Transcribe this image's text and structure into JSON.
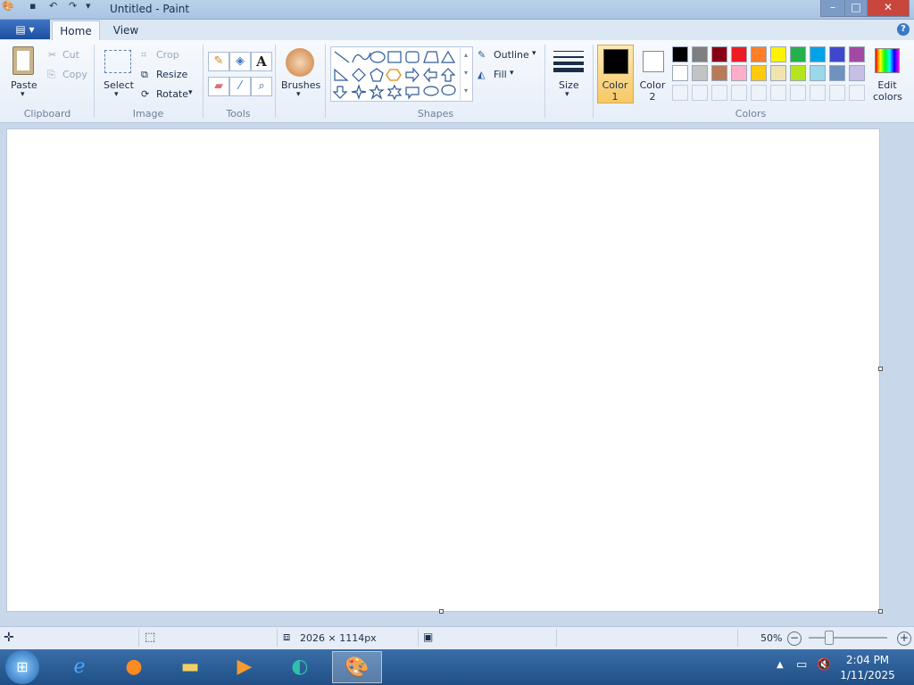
{
  "window": {
    "title": "Untitled - Paint"
  },
  "titlebar": {
    "minimize": "–",
    "maximize": "□",
    "close": "✕"
  },
  "ribbon_tabs": {
    "app_menu": "▤ ▾",
    "home": "Home",
    "view": "View"
  },
  "clipboard": {
    "paste": "Paste",
    "cut": "Cut",
    "copy": "Copy",
    "label": "Clipboard"
  },
  "image": {
    "select": "Select",
    "crop": "Crop",
    "resize": "Resize",
    "rotate": "Rotate",
    "label": "Image"
  },
  "tools": {
    "label": "Tools"
  },
  "brushes": {
    "label": "Brushes"
  },
  "shapes": {
    "outline": "Outline",
    "fill": "Fill",
    "label": "Shapes"
  },
  "size": {
    "label": "Size"
  },
  "color1": {
    "label": "Color 1",
    "value": "#000000"
  },
  "color2": {
    "label": "Color 2",
    "value": "#ffffff"
  },
  "edit_colors": {
    "label": "Edit colors"
  },
  "colors": {
    "label": "Colors",
    "row1": [
      "#000000",
      "#7f7f7f",
      "#880015",
      "#ed1c24",
      "#ff7f27",
      "#fff200",
      "#22b14c",
      "#00a2e8",
      "#3f48cc",
      "#a349a4"
    ],
    "row2": [
      "#ffffff",
      "#c3c3c3",
      "#b97a57",
      "#ffaec9",
      "#ffc90e",
      "#efe4b0",
      "#b5e61d",
      "#99d9ea",
      "#7092be",
      "#c8bfe7"
    ]
  },
  "status": {
    "dimensions": "2026 × 1114px",
    "zoom": "50%"
  },
  "taskbar": {
    "time": "2:04 PM",
    "date": "1/11/2025"
  }
}
